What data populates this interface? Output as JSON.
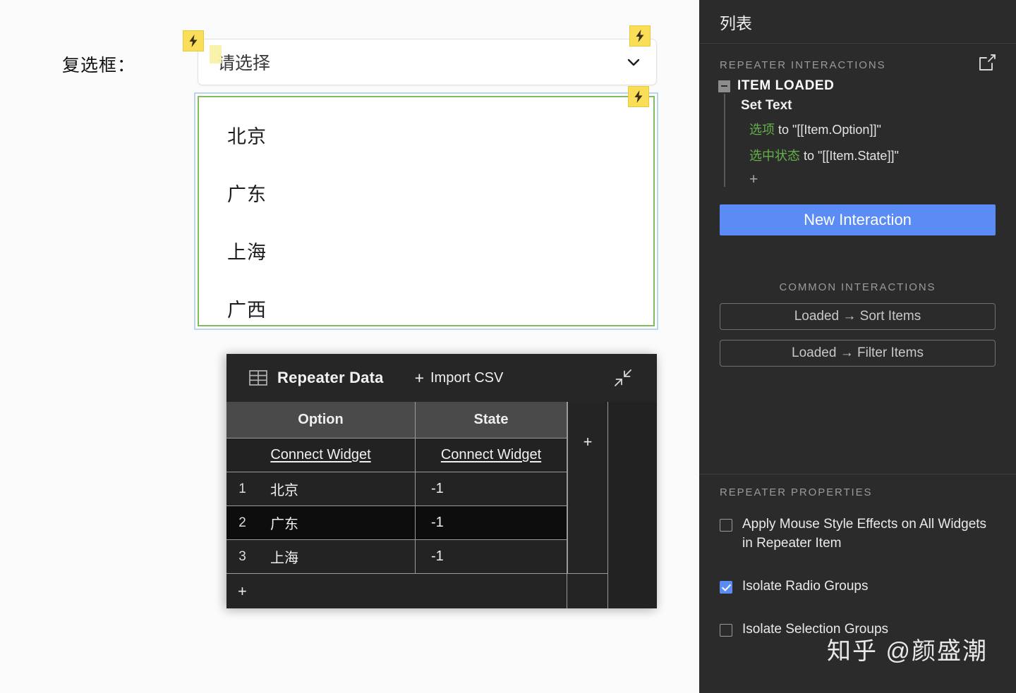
{
  "canvas": {
    "field_label": "复选框：",
    "select": {
      "placeholder": "请选择",
      "caret_icon": "chevron-down-icon"
    },
    "bolt_icon": "lightning-bolt-icon",
    "list_items": [
      "北京",
      "广东",
      "上海",
      "广西"
    ]
  },
  "repeater_data": {
    "panel_icon": "table-grid-icon",
    "title": "Repeater Data",
    "import_label": "Import CSV",
    "import_plus": "+",
    "collapse_icon": "collapse-arrows-icon",
    "columns": [
      "Option",
      "State"
    ],
    "connect_label": "Connect Widget",
    "add_column_label": "+",
    "add_row_label": "+",
    "rows": [
      {
        "num": "1",
        "option": "北京",
        "state": "-1"
      },
      {
        "num": "2",
        "option": "广东",
        "state": "-1"
      },
      {
        "num": "3",
        "option": "上海",
        "state": "-1"
      }
    ]
  },
  "right_panel": {
    "title": "列表",
    "interactions_label": "REPEATER INTERACTIONS",
    "external_link_icon": "external-link-icon",
    "event": {
      "name": "ITEM LOADED",
      "toggle_icon": "minus-collapse-icon",
      "action": "Set Text",
      "details": [
        {
          "target": "选项",
          "rest": " to \"[[Item.Option]]\""
        },
        {
          "target": "选中状态",
          "rest": " to \"[[Item.State]]\""
        }
      ],
      "add_action": "+"
    },
    "new_interaction_label": "New Interaction",
    "common_label": "COMMON INTERACTIONS",
    "common_buttons": [
      "Loaded → Sort Items",
      "Loaded → Filter Items"
    ],
    "properties_label": "REPEATER PROPERTIES",
    "properties": [
      {
        "label": "Apply Mouse Style Effects on All Widgets in Repeater Item",
        "checked": false
      },
      {
        "label": "Isolate Radio Groups",
        "checked": true
      },
      {
        "label": "Isolate Selection Groups",
        "checked": false
      }
    ],
    "accent_color": "#5b8cf5"
  },
  "watermark": "知乎 @颜盛潮"
}
